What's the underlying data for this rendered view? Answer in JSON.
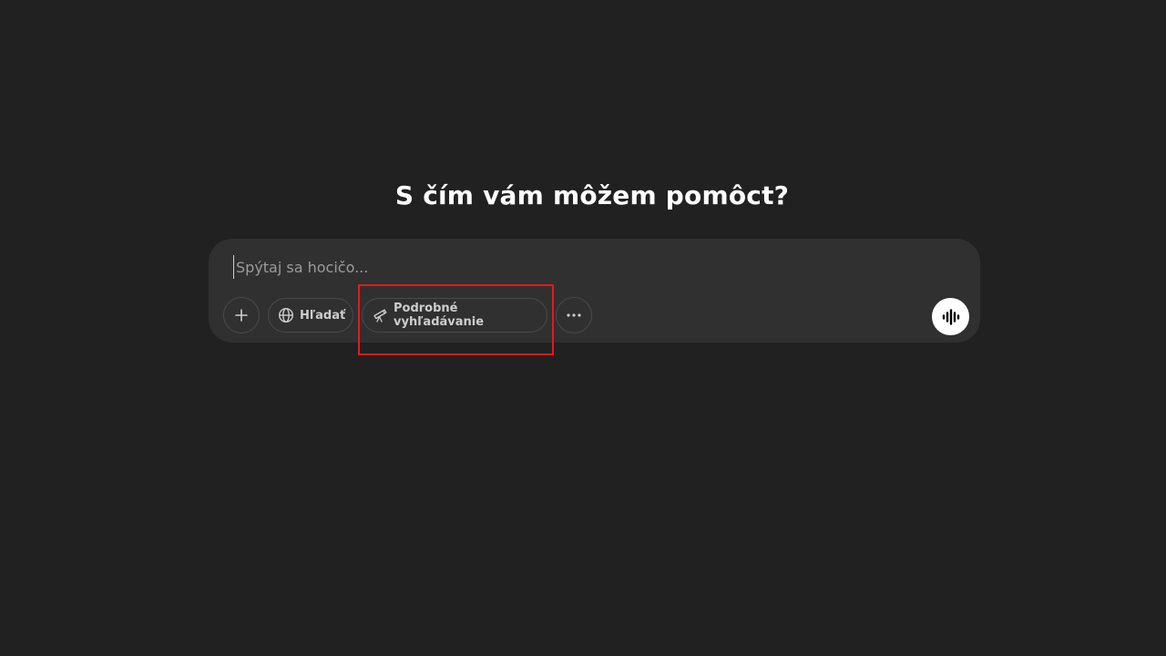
{
  "headline": "S čím vám môžem pomôct?",
  "composer": {
    "placeholder": "Spýtaj sa hocičo...",
    "value": ""
  },
  "toolbar": {
    "add_icon": "plus-icon",
    "search": {
      "label": "Hľadať",
      "icon": "globe-icon"
    },
    "research": {
      "label": "Podrobné vyhľadávanie",
      "icon": "telescope-icon"
    },
    "more_icon": "ellipsis-icon"
  },
  "voice_icon": "voice-waveform-icon",
  "colors": {
    "background": "#212121",
    "composer": "#303030",
    "pill_border": "#4a4a4a",
    "highlight": "#e21b1b"
  }
}
